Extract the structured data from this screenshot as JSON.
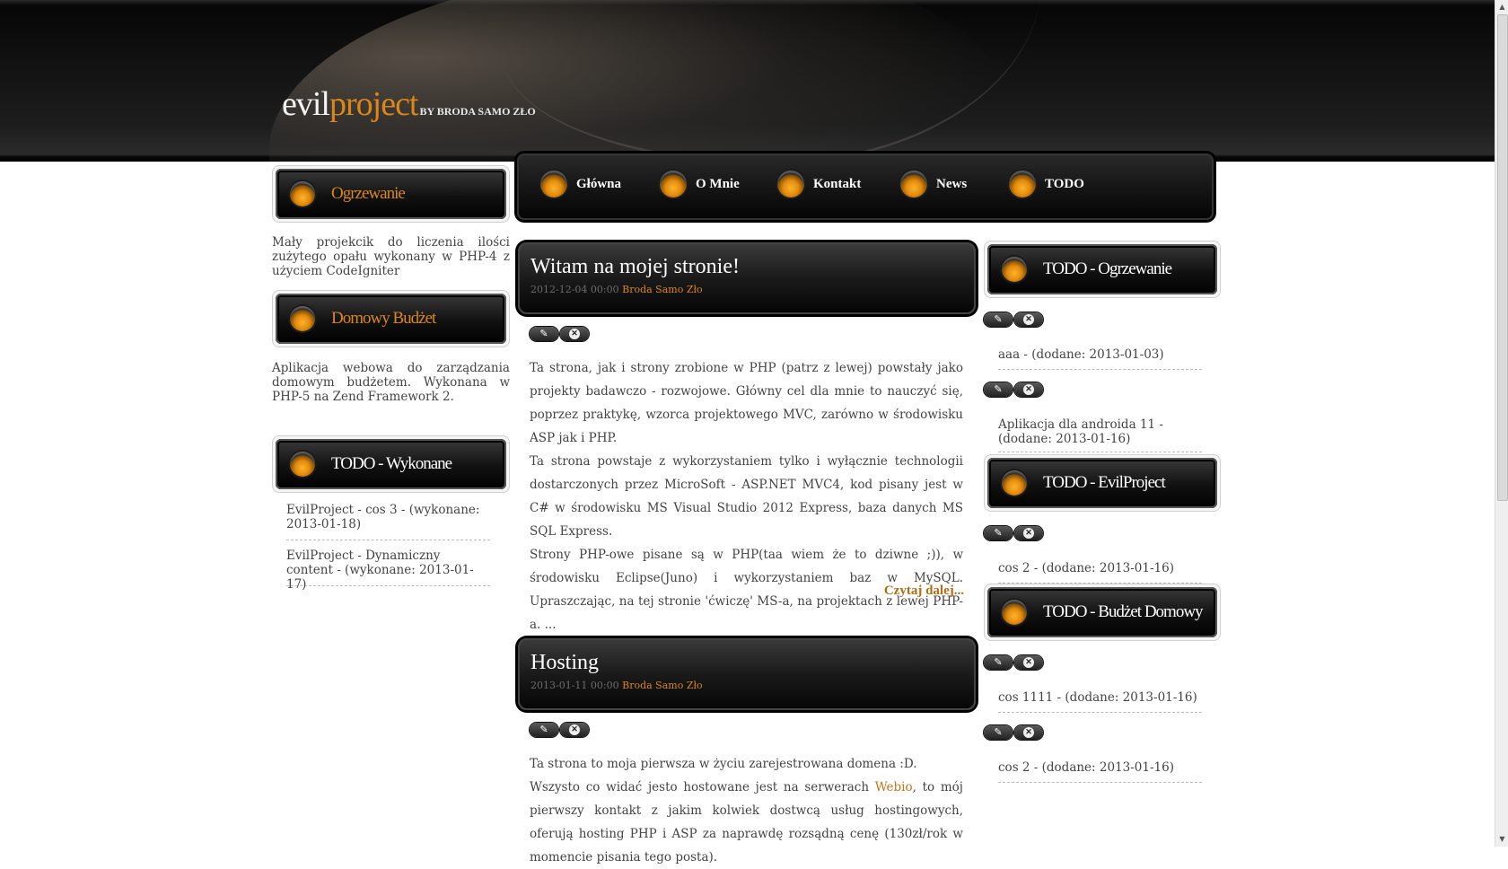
{
  "header": {
    "logo_part1": "evil",
    "logo_part2": "project",
    "byline": "BY BRODA SAMO ZŁO"
  },
  "nav": {
    "items": [
      {
        "label": "Główna"
      },
      {
        "label": "O Mnie"
      },
      {
        "label": "Kontakt"
      },
      {
        "label": "News"
      },
      {
        "label": "TODO"
      }
    ]
  },
  "left": {
    "projects": [
      {
        "title": "Ogrzewanie",
        "description": "Mały projekcik do liczenia ilości zużytego opału wykonany w PHP-4 z użyciem CodeIgniter"
      },
      {
        "title": "Domowy Budżet",
        "description": "Aplikacja webowa do zarządzania domowym budżetem. Wykonana w PHP-5 na Zend Framework 2."
      }
    ],
    "todo_done": {
      "title": "TODO - Wykonane",
      "items": [
        "EvilProject - cos 3 - (wykonane: 2013-01-18)",
        "EvilProject - Dynamiczny content - (wykonane: 2013-01-17)"
      ]
    }
  },
  "posts": [
    {
      "title": "Witam na mojej stronie!",
      "date": "2012-12-04 00:00",
      "author": "Broda Samo Zło",
      "paragraphs": [
        "Ta strona, jak i strony zrobione w PHP (patrz z lewej) powstały jako projekty badawczo - rozwojowe. Główny cel dla mnie to nauczyć się, poprzez praktykę, wzorca projektowego MVC, zarówno w środowisku ASP jak i PHP.",
        "Ta strona powstaje z wykorzystaniem tylko i wyłącznie technologii dostarczonych przez MicroSoft - ASP.NET MVC4, kod pisany jest w C# w środowisku MS Visual Studio 2012 Express, baza danych MS SQL Express.",
        "Strony PHP-owe pisane są w PHP(taa wiem że to dziwne ;)), w środowisku Eclipse(Juno) i wykorzystaniem baz w MySQL. Upraszczając, na tej stronie 'ćwiczę' MS-a, na projektach z lewej PHP-a. ..."
      ],
      "read_more": "Czytaj dalej..."
    },
    {
      "title": "Hosting",
      "date": "2013-01-11 00:00",
      "author": "Broda Samo Zło",
      "p1": "Ta strona to moja pierwsza w życiu zarejestrowana domena :D.",
      "p2_before": "Wszysto co widać jesto hostowane jest na serwerach ",
      "p2_link": "Webio",
      "p2_after": ", to mój pierwszy kontakt z jakim kolwiek dostwcą usług hostingowych, oferują hosting PHP i ASP za naprawdę rozsądną cenę (130zł/rok w momencie pisania tego posta)."
    }
  ],
  "right": {
    "boxes": [
      {
        "title": "TODO - Ogrzewanie",
        "items": [
          "aaa - (dodane: 2013-01-03)",
          "Aplikacja dla androida 11 - (dodane: 2013-01-16)"
        ]
      },
      {
        "title": "TODO - EvilProject",
        "items": [
          "cos 2 - (dodane: 2013-01-16)"
        ]
      },
      {
        "title": "TODO - Budżet Domowy",
        "items": [
          "cos 1111 - (dodane: 2013-01-16)",
          "cos 2 - (dodane: 2013-01-16)"
        ]
      }
    ]
  },
  "icons": {
    "edit": "pencil-icon",
    "delete": "close-circle-icon"
  },
  "colors": {
    "accent": "#d9861a",
    "header_bg": "#0d0d0d",
    "text": "#444444"
  }
}
